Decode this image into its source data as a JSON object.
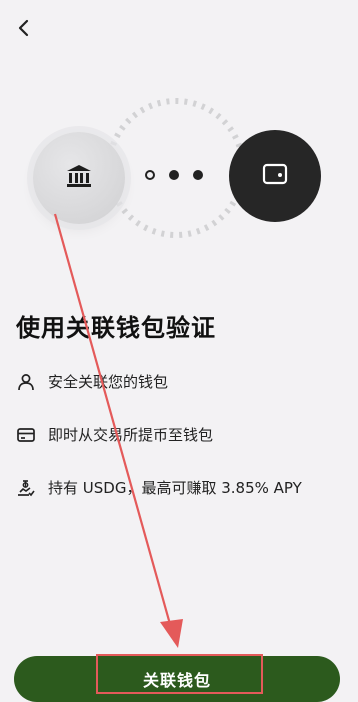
{
  "header": {
    "back_icon": "chevron-left-icon"
  },
  "hero": {
    "left_icon": "bank-icon",
    "right_icon": "wallet-icon",
    "steps": [
      "hollow",
      "filled",
      "filled"
    ]
  },
  "title": "使用关联钱包验证",
  "features": [
    {
      "icon": "person-icon",
      "text": "安全关联您的钱包"
    },
    {
      "icon": "card-icon",
      "text": "即时从交易所提币至钱包"
    },
    {
      "icon": "reward-icon",
      "text": "持有 USDG，最高可赚取 3.85% APY"
    }
  ],
  "cta": {
    "label": "关联钱包"
  },
  "annotation": {
    "color": "#e45a5a"
  },
  "colors": {
    "primary": "#2c5a1d",
    "wallet_bg": "#262626",
    "background": "#f3f2f4"
  }
}
